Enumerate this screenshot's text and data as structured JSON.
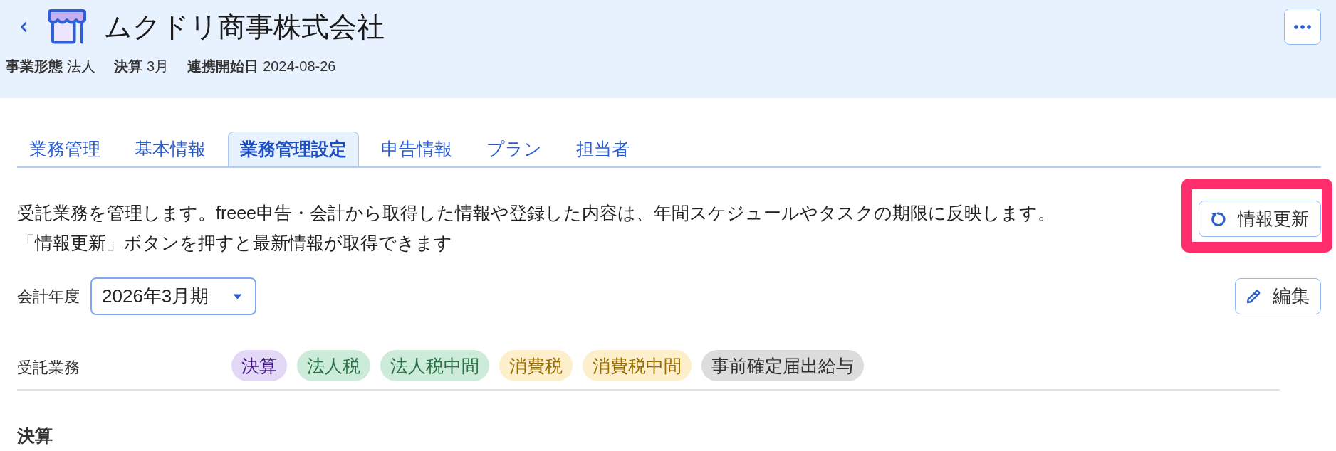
{
  "header": {
    "title": "ムクドリ商事株式会社",
    "meta": [
      {
        "label": "事業形態",
        "value": "法人"
      },
      {
        "label": "決算",
        "value": "3月"
      },
      {
        "label": "連携開始日",
        "value": "2024-08-26"
      }
    ]
  },
  "tabs": [
    {
      "label": "業務管理",
      "selected": false
    },
    {
      "label": "基本情報",
      "selected": false
    },
    {
      "label": "業務管理設定",
      "selected": true
    },
    {
      "label": "申告情報",
      "selected": false
    },
    {
      "label": "プラン",
      "selected": false
    },
    {
      "label": "担当者",
      "selected": false
    }
  ],
  "description": [
    "受託業務を管理します。freee申告・会計から取得した情報や登録した内容は、年間スケジュールやタスクの期限に反映します。",
    "「情報更新」ボタンを押すと最新情報が取得できます"
  ],
  "refresh_button": {
    "label": "情報更新",
    "highlighted": true
  },
  "fiscal_year": {
    "label": "会計年度",
    "value": "2026年3月期"
  },
  "edit_button": {
    "label": "編集"
  },
  "services": {
    "label": "受託業務",
    "tags": [
      {
        "label": "決算",
        "color": "#e4d8f7"
      },
      {
        "label": "法人税",
        "color": "#cdebd9"
      },
      {
        "label": "法人税中間",
        "color": "#cdebd9"
      },
      {
        "label": "消費税",
        "color": "#fdefcb"
      },
      {
        "label": "消費税中間",
        "color": "#fdefcb"
      },
      {
        "label": "事前確定届出給与",
        "color": "#dcdcdc"
      }
    ]
  },
  "section_title": "決算"
}
